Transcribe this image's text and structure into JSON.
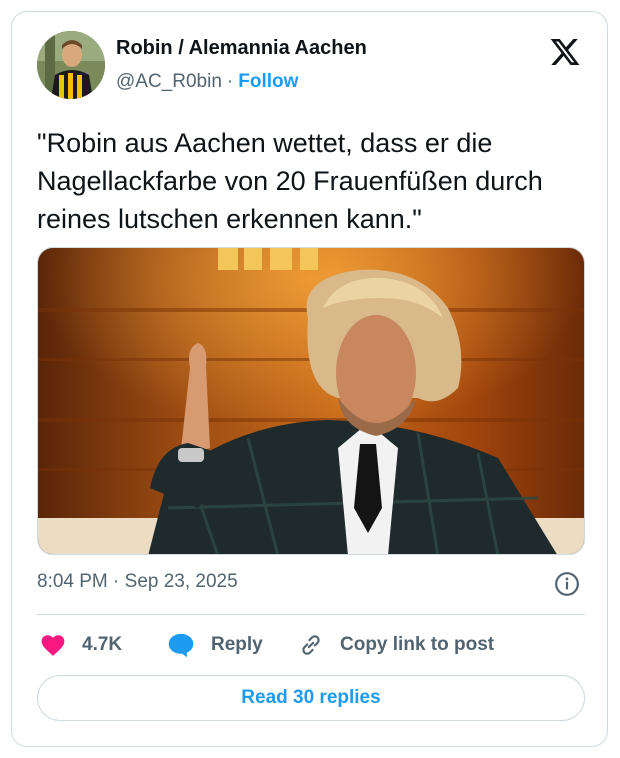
{
  "author": {
    "name": "Robin / Alemannia Aachen",
    "handle": "@AC_R0bin",
    "separator": "·",
    "follow_label": "Follow"
  },
  "tweet": {
    "text": "\"Robin aus Aachen wettet, dass er die Nagellackfarbe von 20 Frauenfüßen durch reines lutschen erkennen kann.\"",
    "timestamp": "8:04 PM · Sep 23, 2025"
  },
  "actions": {
    "like_count": "4.7K",
    "reply_label": "Reply",
    "copy_label": "Copy link to post"
  },
  "footer": {
    "read_replies_label": "Read 30 replies"
  },
  "icons": {
    "platform": "x-logo-icon",
    "info": "info-icon",
    "like": "heart-icon",
    "reply": "speech-bubble-icon",
    "copy": "link-icon"
  },
  "colors": {
    "accent": "#1d9bf0",
    "like": "#f91880",
    "secondary_text": "#536471",
    "border": "#cfd9de"
  }
}
